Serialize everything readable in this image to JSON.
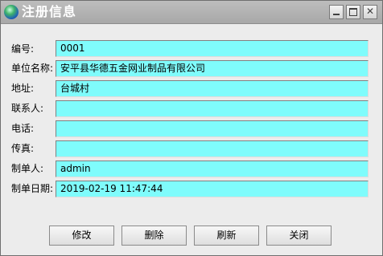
{
  "window": {
    "title": "注册信息"
  },
  "form": {
    "rows": [
      {
        "label": "编号:",
        "value": "0001"
      },
      {
        "label": "单位名称:",
        "value": "安平县华德五金网业制品有限公司"
      },
      {
        "label": "地址:",
        "value": "台城村"
      },
      {
        "label": "联系人:",
        "value": ""
      },
      {
        "label": "电话:",
        "value": ""
      },
      {
        "label": "传真:",
        "value": ""
      },
      {
        "label": "制单人:",
        "value": "admin"
      },
      {
        "label": "制单日期:",
        "value": "2019-02-19 11:47:44"
      }
    ]
  },
  "buttons": {
    "modify": "修改",
    "delete": "删除",
    "refresh": "刷新",
    "close": "关闭"
  },
  "colors": {
    "field_background": "#7ffcfc",
    "titlebar": "#b4b4b4",
    "window_background": "#ececec"
  }
}
